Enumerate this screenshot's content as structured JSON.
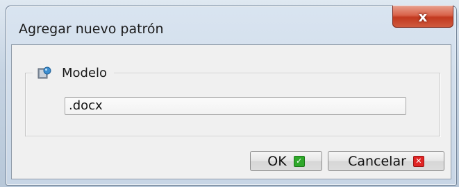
{
  "dialog": {
    "title": "Agregar nuevo patrón",
    "close_glyph": "x",
    "group": {
      "label": "Modelo",
      "icon": "template-icon"
    },
    "field": {
      "value": ".docx"
    },
    "buttons": {
      "ok_label": "OK",
      "ok_icon": "check-icon",
      "cancel_label": "Cancelar",
      "cancel_icon": "cross-icon"
    }
  },
  "colors": {
    "close_button": "#c2391f",
    "ok_badge": "#2fa82b",
    "cancel_badge": "#e02525"
  }
}
